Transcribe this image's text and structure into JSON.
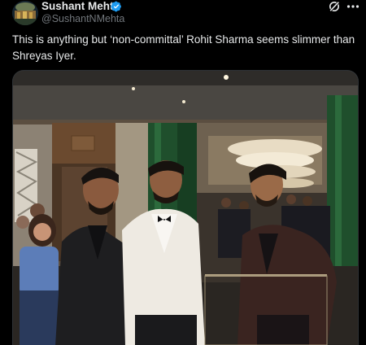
{
  "post": {
    "author": {
      "name": "Sushant Mehta",
      "handle": "@SushantNMehta",
      "verified": true,
      "verified_color": "#1d9bf0"
    },
    "text": "This is anything but ‘non-committal’ Rohit Sharma seems slimmer than Shreyas Iyer.",
    "actions": {
      "grok_icon": "grok-icon",
      "more_icon": "more-options-icon"
    },
    "media": {
      "type": "photo"
    }
  },
  "colors": {
    "background": "#000000",
    "text": "#e7e9ea",
    "secondary_text": "#71767b",
    "border": "#2f3336"
  }
}
